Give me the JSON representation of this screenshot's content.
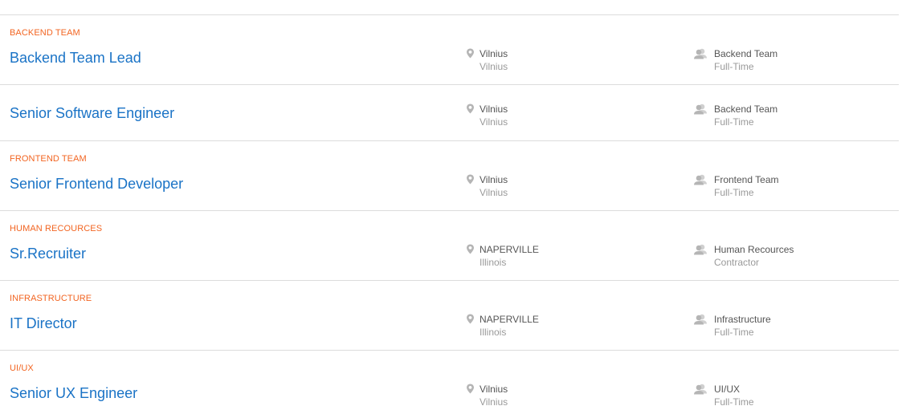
{
  "colors": {
    "team_label": "#f26522",
    "job_title_link": "#1a73c6",
    "divider": "#dcdcdc",
    "meta_primary": "#555555",
    "meta_secondary": "#9a9a9a",
    "icon": "#b5b5b5"
  },
  "icons": {
    "location": "map-pin-icon",
    "team": "people-icon"
  },
  "jobs": [
    {
      "team_label": "BACKEND TEAM",
      "title": "Backend Team Lead",
      "location_city": "Vilnius",
      "location_region": "Vilnius",
      "team": "Backend Team",
      "employment_type": "Full-Time"
    },
    {
      "team_label": "",
      "title": "Senior Software Engineer",
      "location_city": "Vilnius",
      "location_region": "Vilnius",
      "team": "Backend Team",
      "employment_type": "Full-Time"
    },
    {
      "team_label": "FRONTEND TEAM",
      "title": "Senior Frontend Developer",
      "location_city": "Vilnius",
      "location_region": "Vilnius",
      "team": "Frontend Team",
      "employment_type": "Full-Time"
    },
    {
      "team_label": "HUMAN RECOURCES",
      "title": "Sr.Recruiter",
      "location_city": "NAPERVILLE",
      "location_region": "Illinois",
      "team": "Human Recources",
      "employment_type": "Contractor"
    },
    {
      "team_label": "INFRASTRUCTURE",
      "title": "IT Director",
      "location_city": "NAPERVILLE",
      "location_region": "Illinois",
      "team": "Infrastructure",
      "employment_type": "Full-Time"
    },
    {
      "team_label": "UI/UX",
      "title": "Senior UX Engineer",
      "location_city": "Vilnius",
      "location_region": "Vilnius",
      "team": "UI/UX",
      "employment_type": "Full-Time"
    }
  ]
}
